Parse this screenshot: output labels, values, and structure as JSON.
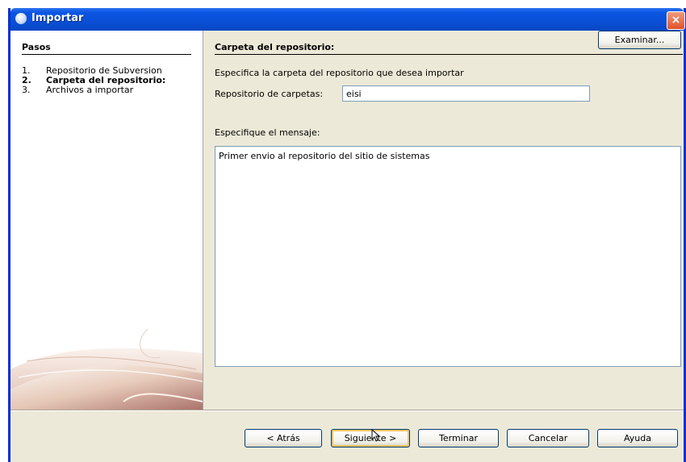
{
  "window": {
    "title": "Importar",
    "close_label": "×"
  },
  "steps": {
    "header": "Pasos",
    "items": [
      {
        "num": "1.",
        "label": "Repositorio de Subversion"
      },
      {
        "num": "2.",
        "label": "Carpeta del repositorio:"
      },
      {
        "num": "3.",
        "label": "Archivos a importar"
      }
    ],
    "active_index": 1
  },
  "panel": {
    "title": "Carpeta del repositorio:",
    "description": "Especifica la carpeta del repositorio que desea importar",
    "repo_label": "Repositorio de carpetas:",
    "repo_value": "eisi",
    "browse_label": "Examinar...",
    "message_label": "Especifique el mensaje:",
    "message_value": "Primer envio al repositorio del sitio de sistemas"
  },
  "buttons": {
    "back": "< Atrás",
    "next": "Siguiente >",
    "finish": "Terminar",
    "cancel": "Cancelar",
    "help": "Ayuda"
  },
  "colors": {
    "titlebar": "#0a4fd6",
    "dialog_bg": "#ece9d8",
    "close": "#e0522a"
  }
}
